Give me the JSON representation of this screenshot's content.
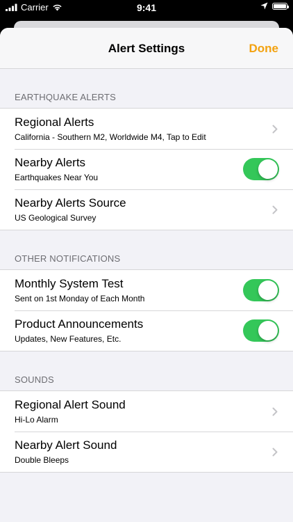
{
  "status_bar": {
    "carrier": "Carrier",
    "time": "9:41"
  },
  "nav": {
    "title": "Alert Settings",
    "done_label": "Done"
  },
  "colors": {
    "accent": "#f3a210",
    "toggle_on": "#34c759"
  },
  "sections": {
    "earthquake": {
      "header": "EARTHQUAKE ALERTS",
      "regional": {
        "title": "Regional Alerts",
        "subtitle": "California - Southern M2, Worldwide M4, Tap to Edit"
      },
      "nearby": {
        "title": "Nearby Alerts",
        "subtitle": "Earthquakes Near You",
        "enabled": true
      },
      "source": {
        "title": "Nearby Alerts Source",
        "subtitle": "US Geological Survey"
      }
    },
    "other": {
      "header": "OTHER NOTIFICATIONS",
      "monthly": {
        "title": "Monthly System Test",
        "subtitle": "Sent on 1st Monday of Each Month",
        "enabled": true
      },
      "product": {
        "title": "Product Announcements",
        "subtitle": "Updates, New Features, Etc.",
        "enabled": true
      }
    },
    "sounds": {
      "header": "SOUNDS",
      "regional_sound": {
        "title": "Regional Alert Sound",
        "subtitle": "Hi-Lo Alarm"
      },
      "nearby_sound": {
        "title": "Nearby Alert Sound",
        "subtitle": "Double Bleeps"
      }
    }
  }
}
